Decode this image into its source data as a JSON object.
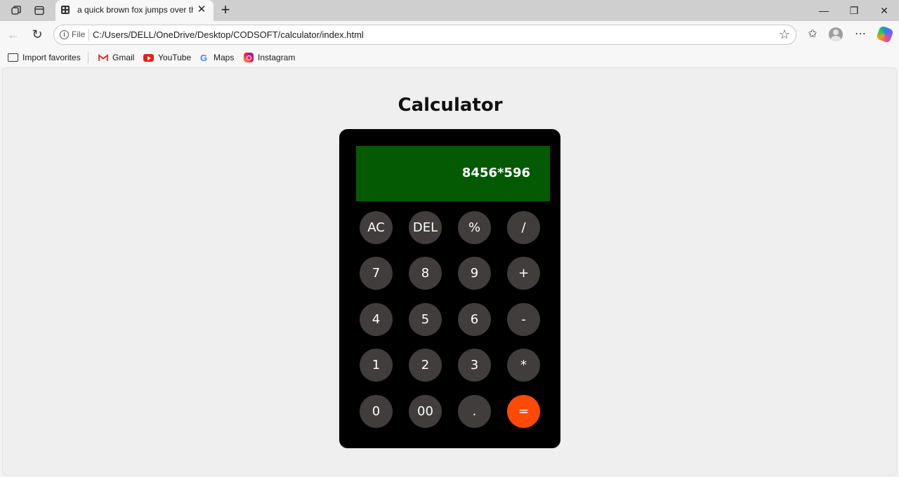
{
  "browser": {
    "tab": {
      "title": "a quick brown fox jumps over the",
      "close": "✕"
    },
    "new_tab": "+",
    "window": {
      "minimize": "—",
      "restore": "❐",
      "close": "✕"
    },
    "address": {
      "scheme_chip": "File",
      "url": "C:/Users/DELL/OneDrive/Desktop/CODSOFT/calculator/index.html"
    },
    "favorites": [
      {
        "label": "Import favorites",
        "icon": "import-icon"
      },
      {
        "label": "Gmail",
        "icon": "gmail-icon"
      },
      {
        "label": "YouTube",
        "icon": "youtube-icon"
      },
      {
        "label": "Maps",
        "icon": "google-icon"
      },
      {
        "label": "Instagram",
        "icon": "instagram-icon"
      }
    ]
  },
  "page": {
    "title": "Calculator",
    "display": "8456*596",
    "keys": [
      "AC",
      "DEL",
      "%",
      "/",
      "7",
      "8",
      "9",
      "+",
      "4",
      "5",
      "6",
      "-",
      "1",
      "2",
      "3",
      "*",
      "0",
      "00",
      ".",
      "="
    ]
  },
  "colors": {
    "calc_body": "#000000",
    "display_bg": "#045a03",
    "key_bg": "#423d3d",
    "equals_bg": "#ff4a06"
  }
}
